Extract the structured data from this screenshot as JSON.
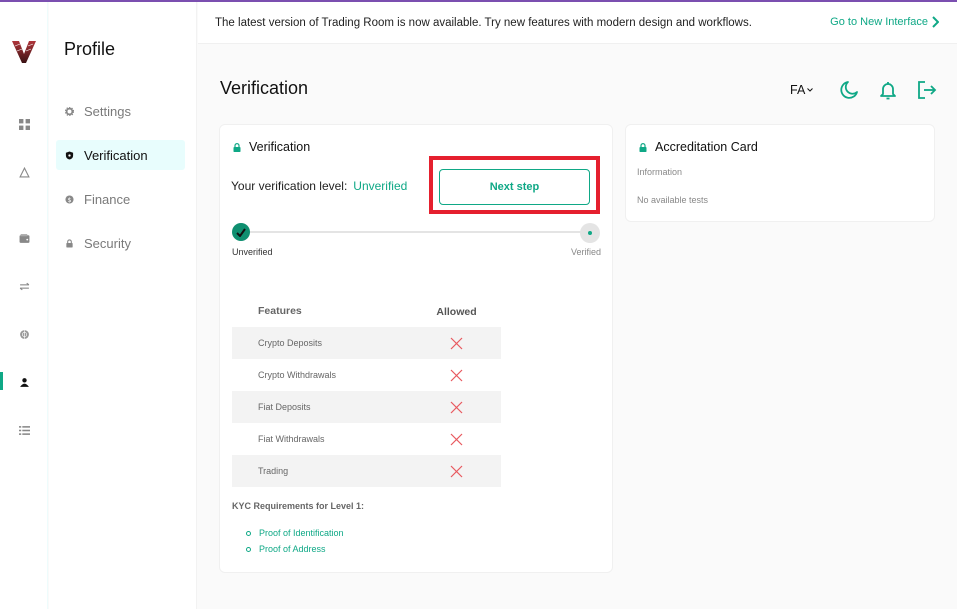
{
  "banner": {
    "message": "The latest version of Trading Room is now available. Try new features with modern design and workflows.",
    "link_label": "Go to New Interface"
  },
  "rail": {
    "items": [
      {
        "name": "dashboard",
        "icon": "grid-icon"
      },
      {
        "name": "market",
        "icon": "triangle-icon"
      },
      {
        "name": "wallet",
        "icon": "wallet-icon"
      },
      {
        "name": "exchange",
        "icon": "exchange-icon"
      },
      {
        "name": "global",
        "icon": "globe-icon"
      },
      {
        "name": "profile",
        "icon": "user-icon",
        "active": true
      },
      {
        "name": "orders",
        "icon": "list-icon"
      }
    ]
  },
  "sidebar": {
    "title": "Profile",
    "items": [
      {
        "label": "Settings",
        "icon": "gear-icon"
      },
      {
        "label": "Verification",
        "icon": "shield-icon",
        "active": true
      },
      {
        "label": "Finance",
        "icon": "coin-icon"
      },
      {
        "label": "Security",
        "icon": "lock-icon"
      }
    ]
  },
  "header": {
    "title": "Verification",
    "language": "FA"
  },
  "verification": {
    "title": "Verification",
    "level_label": "Your verification level:",
    "level_value": "Unverified",
    "next_button": "Next step",
    "progress": {
      "current_step": 1,
      "total_steps": 2,
      "start_label": "Unverified",
      "end_label": "Verified"
    },
    "table": {
      "headers": [
        "Features",
        "Allowed"
      ],
      "rows": [
        {
          "feature": "Crypto Deposits",
          "allowed": false
        },
        {
          "feature": "Crypto Withdrawals",
          "allowed": false
        },
        {
          "feature": "Fiat Deposits",
          "allowed": false
        },
        {
          "feature": "Fiat Withdrawals",
          "allowed": false
        },
        {
          "feature": "Trading",
          "allowed": false
        }
      ]
    },
    "kyc_title": "KYC Requirements for Level 1:",
    "kyc_items": [
      "Proof of Identification",
      "Proof of Address"
    ]
  },
  "accreditation": {
    "title": "Accreditation Card",
    "info_label": "Information",
    "empty_text": "No available tests"
  },
  "colors": {
    "accent": "#0fa886",
    "highlight": "#e5202e",
    "deny": "#e8585e",
    "topbar": "#7b4fb0"
  }
}
